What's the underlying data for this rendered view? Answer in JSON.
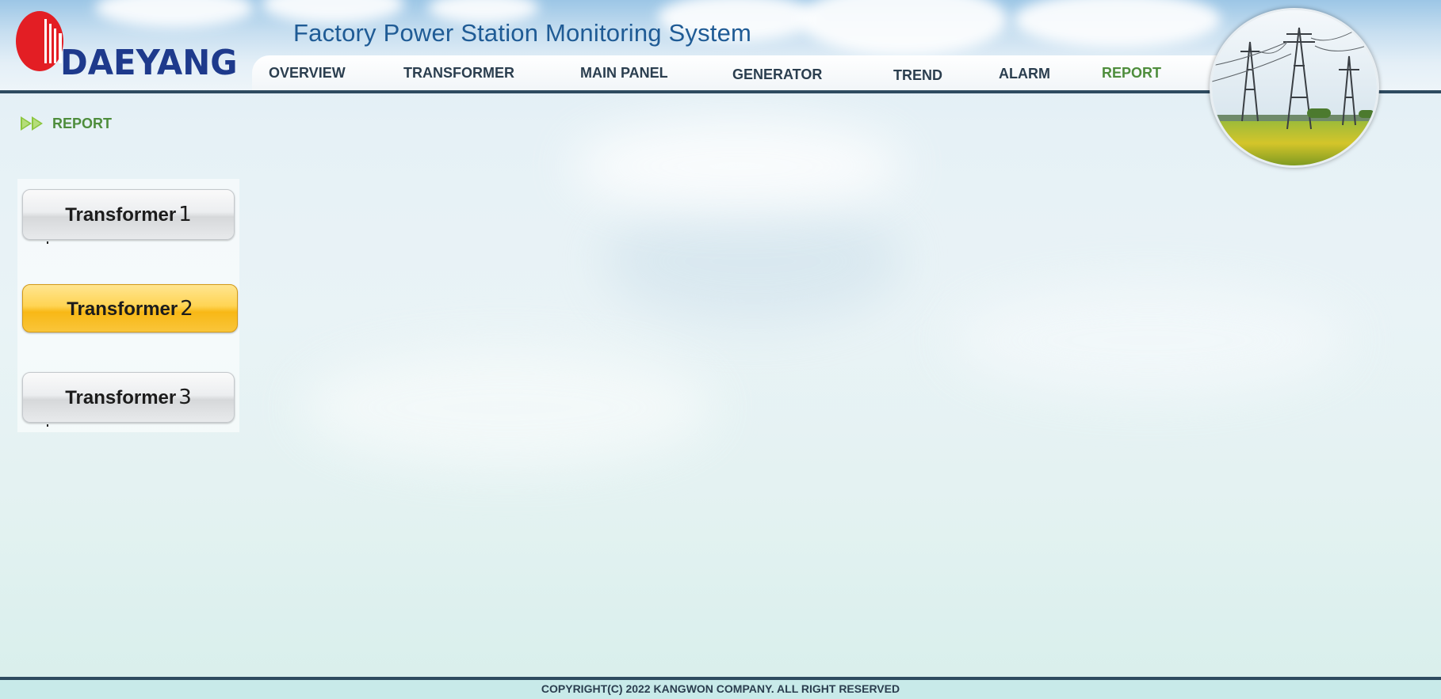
{
  "brand": {
    "logo_text": "DAEYANG",
    "logo_color": "#1e3a8c",
    "logo_mark_color": "#e31e24",
    "app_title": "Factory Power Station Monitoring System"
  },
  "nav": {
    "items": [
      {
        "label": "OVERVIEW"
      },
      {
        "label": "TRANSFORMER"
      },
      {
        "label": "MAIN PANEL"
      },
      {
        "label": "GENERATOR"
      },
      {
        "label": "TREND"
      },
      {
        "label": "ALARM"
      },
      {
        "label": "REPORT",
        "active": true
      }
    ],
    "active_color": "#4e8d3c"
  },
  "breadcrumb": {
    "icon": "double-arrow-icon",
    "label": "REPORT"
  },
  "transformers": [
    {
      "label": "Transformer",
      "number": "1",
      "selected": false
    },
    {
      "label": "Transformer",
      "number": "2",
      "selected": true
    },
    {
      "label": "Transformer",
      "number": "3",
      "selected": false
    }
  ],
  "footer": {
    "copyright": "COPYRIGHT(C) 2022 KANGWON COMPANY. ALL RIGHT RESERVED"
  },
  "colors": {
    "header_bar": "#2e4b60",
    "selected_button": "#f8b816",
    "footer_bg": "#c8eae9"
  }
}
